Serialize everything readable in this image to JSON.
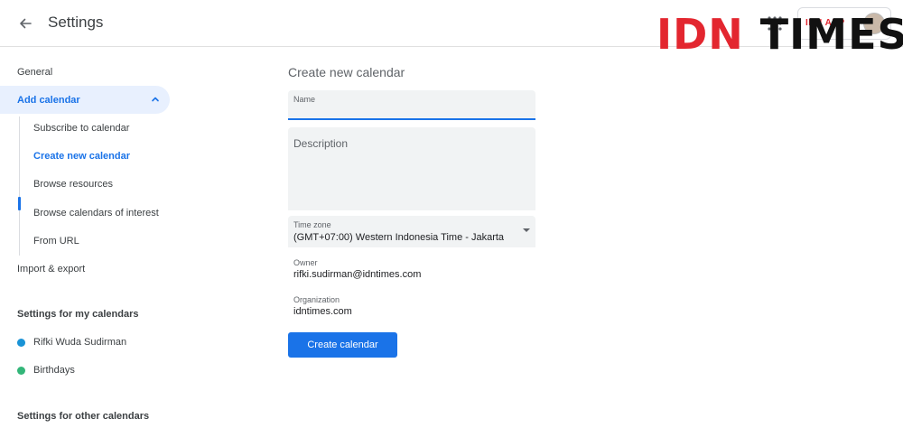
{
  "header": {
    "title": "Settings",
    "back_icon": "arrow-left-icon",
    "apps_icon": "apps-grid-icon",
    "account_label": "IDN APP",
    "accent": "#1a73e8"
  },
  "watermark": {
    "part1": "IDN",
    "part2": "TIMES",
    "color_primary": "#e3262f",
    "color_secondary": "#111111"
  },
  "sidebar": {
    "general": "General",
    "add_calendar": "Add calendar",
    "add_calendar_children": [
      {
        "label": "Subscribe to calendar"
      },
      {
        "label": "Create new calendar"
      },
      {
        "label": "Browse resources"
      },
      {
        "label": "Browse calendars of interest"
      },
      {
        "label": "From URL"
      }
    ],
    "import_export": "Import & export",
    "my_calendars_heading": "Settings for my calendars",
    "my_calendars": [
      {
        "label": "Rifki Wuda Sudirman",
        "color": "#1a93d6"
      },
      {
        "label": "Birthdays",
        "color": "#33b679"
      }
    ],
    "other_calendars_heading": "Settings for other calendars"
  },
  "form": {
    "title": "Create new calendar",
    "name_label": "Name",
    "description_placeholder": "Description",
    "timezone_label": "Time zone",
    "timezone_value": "(GMT+07:00) Western Indonesia Time - Jakarta",
    "owner_label": "Owner",
    "owner_value": "rifki.sudirman@idntimes.com",
    "organization_label": "Organization",
    "organization_value": "idntimes.com",
    "submit_label": "Create calendar"
  }
}
